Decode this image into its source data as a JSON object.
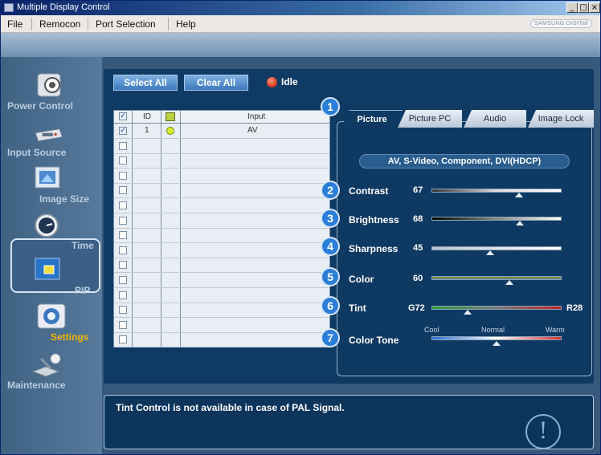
{
  "window": {
    "title": "Multiple Display Control",
    "controls": [
      "_",
      "□",
      "×"
    ]
  },
  "menu": {
    "items": [
      "File",
      "Remocon",
      "Port Selection",
      "Help"
    ],
    "brand": "SAMSUNG DIGITall"
  },
  "sidebar": {
    "items": [
      {
        "label": "Power Control",
        "icon": "power-icon"
      },
      {
        "label": "Input Source",
        "icon": "input-icon"
      },
      {
        "label": "Image Size",
        "icon": "image-size-icon"
      },
      {
        "label": "Time",
        "icon": "clock-icon"
      },
      {
        "label": "PIP",
        "icon": "pip-icon"
      },
      {
        "label": "Settings",
        "icon": "settings-icon",
        "selected": true
      },
      {
        "label": "Maintenance",
        "icon": "maintenance-icon"
      }
    ]
  },
  "toolbar": {
    "select_all": "Select All",
    "clear_all": "Clear All",
    "status": "Idle"
  },
  "grid": {
    "headers": {
      "id": "ID",
      "input": "Input"
    },
    "rows": [
      {
        "checked": true,
        "id": "1",
        "status": "on",
        "input": "AV"
      },
      {
        "checked": false,
        "id": "",
        "input": ""
      },
      {
        "checked": false,
        "id": "",
        "input": ""
      },
      {
        "checked": false,
        "id": "",
        "input": ""
      },
      {
        "checked": false,
        "id": "",
        "input": ""
      },
      {
        "checked": false,
        "id": "",
        "input": ""
      },
      {
        "checked": false,
        "id": "",
        "input": ""
      },
      {
        "checked": false,
        "id": "",
        "input": ""
      },
      {
        "checked": false,
        "id": "",
        "input": ""
      },
      {
        "checked": false,
        "id": "",
        "input": ""
      },
      {
        "checked": false,
        "id": "",
        "input": ""
      },
      {
        "checked": false,
        "id": "",
        "input": ""
      },
      {
        "checked": false,
        "id": "",
        "input": ""
      },
      {
        "checked": false,
        "id": "",
        "input": ""
      },
      {
        "checked": false,
        "id": "",
        "input": ""
      }
    ]
  },
  "tabs": {
    "picture": "Picture",
    "picture_pc": "Picture PC",
    "audio": "Audio",
    "image_lock": "Image Lock",
    "active": "Picture"
  },
  "badges": [
    "1",
    "2",
    "3",
    "4",
    "5",
    "6",
    "7"
  ],
  "settings": {
    "subtitle": "AV, S-Video, Component, DVI(HDCP)",
    "contrast": {
      "label": "Contrast",
      "value": "67",
      "level": 0.67
    },
    "brightness": {
      "label": "Brightness",
      "value": "68",
      "level": 0.68
    },
    "sharpness": {
      "label": "Sharpness",
      "value": "45",
      "level": 0.45
    },
    "color": {
      "label": "Color",
      "value": "60",
      "level": 0.6
    },
    "tint": {
      "label": "Tint",
      "left": "G72",
      "right": "R28",
      "level": 0.28
    },
    "color_tone": {
      "label": "Color Tone",
      "cool": "Cool",
      "normal": "Normal",
      "warm": "Warm",
      "level": 0.5
    }
  },
  "message": {
    "text": "Tint Control is not available in case of PAL Signal.",
    "icon": "warning-icon"
  },
  "colors": {
    "panel": "#0f3a64",
    "accent": "#2b7ed8",
    "status_idle": "#d0341c"
  }
}
